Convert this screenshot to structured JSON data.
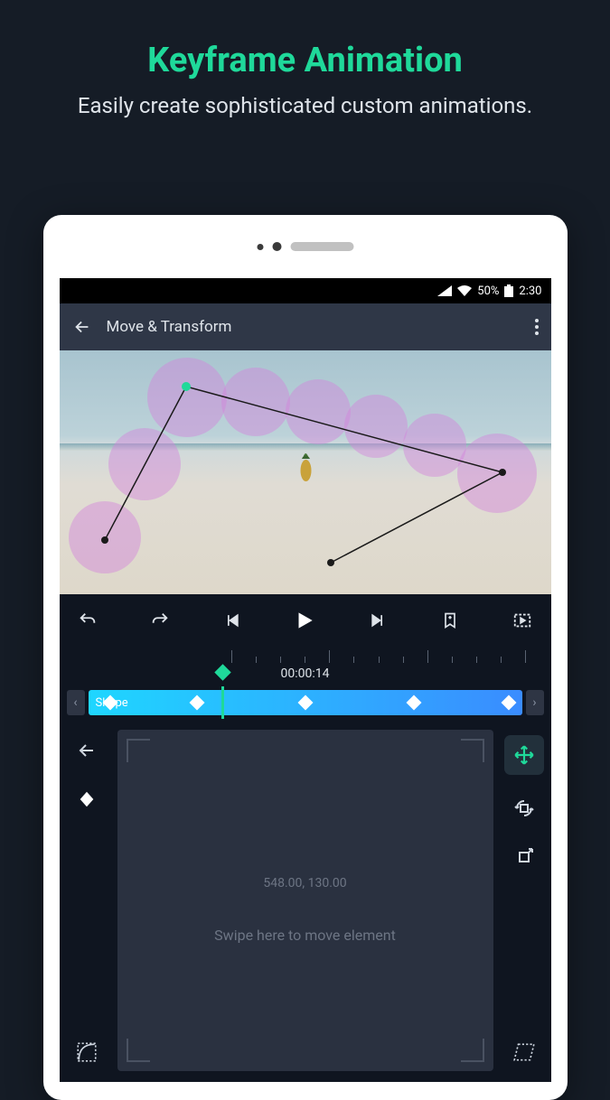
{
  "promo": {
    "title": "Keyframe Animation",
    "subtitle": "Easily create sophisticated custom animations."
  },
  "status": {
    "battery_pct": "50%",
    "time": "2:30"
  },
  "app": {
    "title": "Move & Transform"
  },
  "timeline": {
    "timecode": "00:00:14",
    "clip_label": "Shape"
  },
  "panel": {
    "coords": "548.00, 130.00",
    "hint": "Swipe here to move element"
  },
  "icons": {
    "back": "back-arrow-icon",
    "menu": "more-vertical-icon",
    "undo": "undo-icon",
    "redo": "redo-icon",
    "prev_kf": "skip-start-icon",
    "play": "play-icon",
    "next_kf": "skip-end-icon",
    "bookmark": "bookmark-add-icon",
    "fullscreen": "fullscreen-play-icon",
    "left_back": "back-arrow-icon",
    "keyframe": "keyframe-diamond-icon",
    "easing": "easing-curve-icon",
    "move": "move-arrows-icon",
    "rotate": "rotate-icon",
    "scale": "scale-out-icon",
    "skew": "skew-icon"
  }
}
